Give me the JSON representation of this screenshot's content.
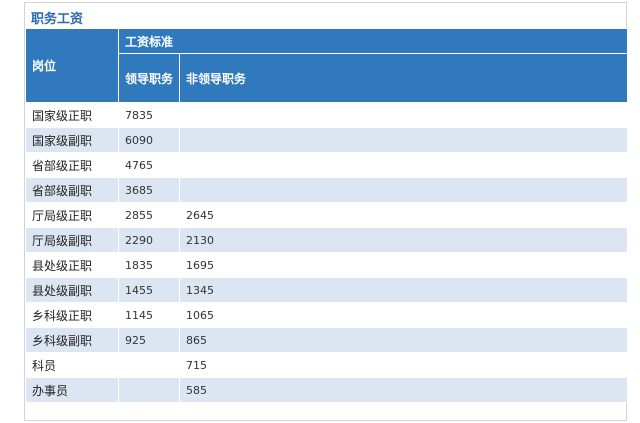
{
  "caption": "职务工资",
  "header": {
    "post": "岗位",
    "standard": "工资标准",
    "leader": "领导职务",
    "nonleader": "非领导职务"
  },
  "rows": [
    {
      "post": "国家级正职",
      "leader": "7835",
      "nonleader": ""
    },
    {
      "post": "国家级副职",
      "leader": "6090",
      "nonleader": ""
    },
    {
      "post": "省部级正职",
      "leader": "4765",
      "nonleader": ""
    },
    {
      "post": "省部级副职",
      "leader": "3685",
      "nonleader": ""
    },
    {
      "post": "厅局级正职",
      "leader": "2855",
      "nonleader": "2645"
    },
    {
      "post": "厅局级副职",
      "leader": "2290",
      "nonleader": "2130"
    },
    {
      "post": "县处级正职",
      "leader": "1835",
      "nonleader": "1695"
    },
    {
      "post": "县处级副职",
      "leader": "1455",
      "nonleader": "1345"
    },
    {
      "post": "乡科级正职",
      "leader": "1145",
      "nonleader": "1065"
    },
    {
      "post": "乡科级副职",
      "leader": "925",
      "nonleader": "865"
    },
    {
      "post": "科员",
      "leader": "",
      "nonleader": "715"
    },
    {
      "post": "办事员",
      "leader": "",
      "nonleader": "585"
    }
  ],
  "colors": {
    "header_bg": "#3079bd",
    "row_alt": "#dce6f2",
    "caption": "#2a6bb0"
  }
}
